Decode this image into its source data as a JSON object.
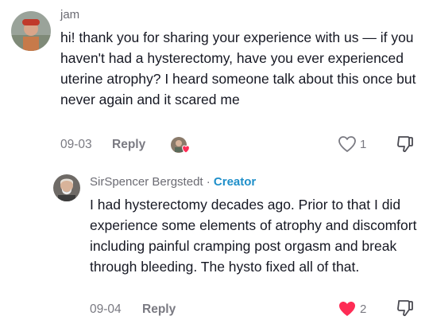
{
  "comment": {
    "username": "jam",
    "text": "hi! thank you for sharing your experience with us — if you haven't had a hysterectomy, have you ever experienced uterine atrophy? I heard someone talk about this once but never again and it scared me",
    "date": "09-03",
    "reply_label": "Reply",
    "like_count": "1"
  },
  "reply": {
    "username": "SirSpencer Bergstedt",
    "separator": "·",
    "creator_badge": "Creator",
    "text": "I had hysterectomy decades ago. Prior to that I did experience some elements of atrophy and discomfort including painful cramping post orgasm and break through bleeding. The hysto fixed all of that.",
    "date": "09-04",
    "reply_label": "Reply",
    "like_count": "2"
  },
  "colors": {
    "liked_heart": "#fe2c55",
    "creator": "#1f8fc9"
  },
  "icons": [
    "heart-outline-icon",
    "heart-filled-icon",
    "dislike-icon",
    "creator-liked-avatar"
  ]
}
